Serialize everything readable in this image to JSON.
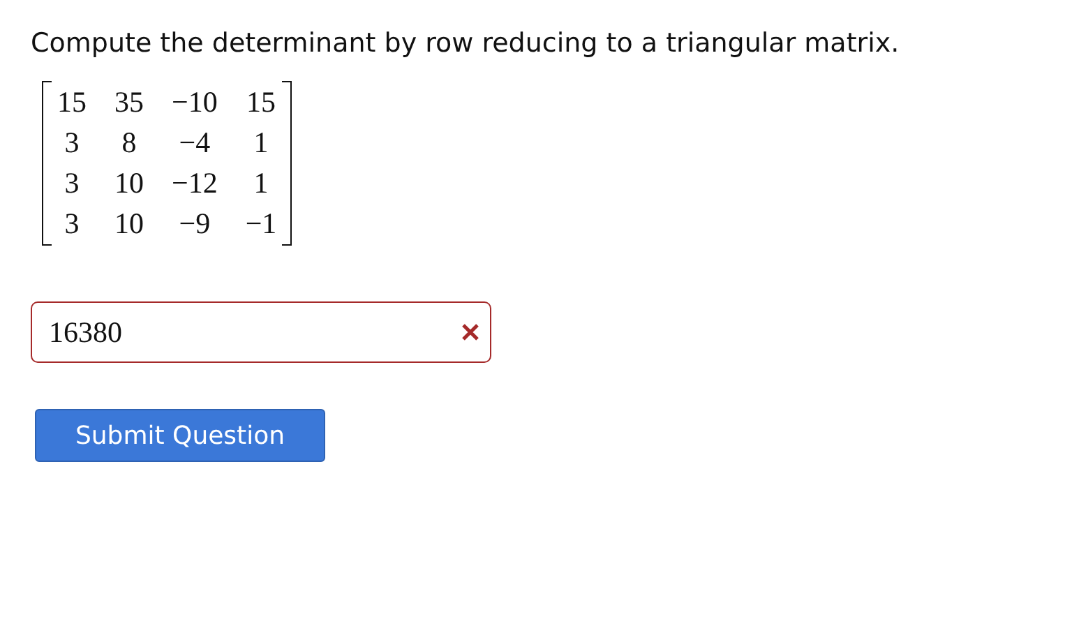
{
  "question": "Compute the determinant by row reducing to a triangular matrix.",
  "matrix": [
    [
      "15",
      "35",
      "−10",
      "15"
    ],
    [
      "3",
      "8",
      "−4",
      "1"
    ],
    [
      "3",
      "10",
      "−12",
      "1"
    ],
    [
      "3",
      "10",
      "−9",
      "−1"
    ]
  ],
  "answer": {
    "value": "16380",
    "correct": false
  },
  "buttons": [
    "Submit Question"
  ]
}
